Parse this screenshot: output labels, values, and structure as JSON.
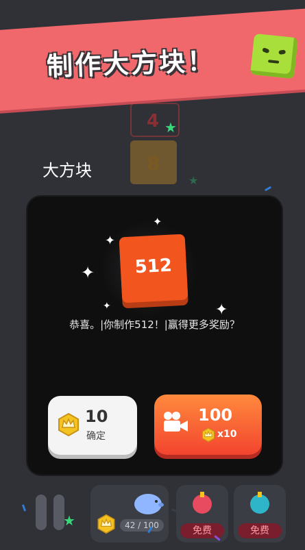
{
  "banner": {
    "title": "制作大方块！"
  },
  "section": {
    "title": "大方块"
  },
  "dialog": {
    "block_value": "512",
    "message": "恭喜。|你制作512！|赢得更多奖励？",
    "confirm": {
      "amount": "10",
      "label": "确定"
    },
    "video": {
      "amount": "100",
      "multiplier": "x10"
    }
  },
  "bottom": {
    "progress": "42 / 100",
    "powerup_free_label": "免费"
  },
  "background_tiles": {
    "top_value_a": "4",
    "top_value_b": "8"
  },
  "colors": {
    "banner": "#f0676c",
    "block": "#f3551f",
    "confirm_button": "#f4f4f4",
    "video_button": "#f3442f",
    "crown": "#f5c320"
  }
}
